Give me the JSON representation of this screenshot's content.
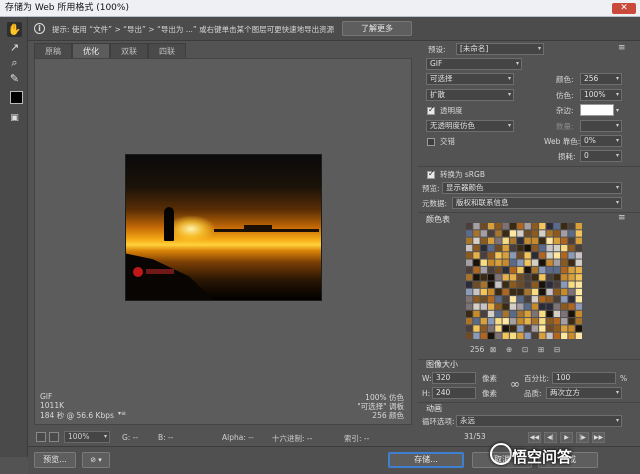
{
  "window": {
    "title": "存储为 Web 所用格式 (100%)",
    "close": "✕"
  },
  "hint": {
    "text": "提示:  使用 “文件” > “导出” > “导出为 ...” 或右键单击某个图层可更快速地导出资源",
    "learn_more": "了解更多"
  },
  "tabs": [
    "原稿",
    "优化",
    "双联",
    "四联"
  ],
  "canvas_info": {
    "format": "GIF",
    "size": "1011K",
    "time": "184 秒 @ 56.6 Kbps",
    "dither_pct": "100% 仿色",
    "palette": "\"可选择\" 调板",
    "colors": "256 颜色"
  },
  "status": {
    "zoom": "100%",
    "g": "G: --",
    "b": "B: --",
    "alpha": "Alpha: --",
    "hex": "十六进制: --",
    "index": "索引: --"
  },
  "bottom": {
    "preview": "预览...",
    "save": "存储...",
    "cancel": "取消",
    "done": "完成"
  },
  "settings": {
    "preset_label": "预设:",
    "preset_value": "[未命名]",
    "format": "GIF",
    "reduction": "可选择",
    "dither_algo": "扩散",
    "colors_label": "颜色:",
    "colors_value": "256",
    "dither_label": "仿色:",
    "dither_value": "100%",
    "transparency_label": "透明度",
    "matte_label": "杂边:",
    "amount_label": "数量:",
    "no_transparency_dither": "无透明度仿色",
    "interlaced_label": "交错",
    "web_snap_label": "Web 靠色:",
    "web_snap_value": "0%",
    "lossy_label": "损耗:",
    "lossy_value": "0",
    "srgb_label": "转换为 sRGB",
    "preview_label": "预览:",
    "preview_value": "显示器颜色",
    "metadata_label": "元数据:",
    "metadata_value": "版权和联系信息",
    "color_table_label": "颜色表",
    "palette_count": "256"
  },
  "image_size": {
    "title": "图像大小",
    "w_label": "W:",
    "w_value": "320",
    "w_unit": "像素",
    "h_label": "H:",
    "h_value": "240",
    "h_unit": "像素",
    "percent_label": "百分比:",
    "percent_value": "100",
    "percent_unit": "%",
    "quality_label": "品质:",
    "quality_value": "两次立方"
  },
  "animation": {
    "title": "动画",
    "loop_label": "循环选项:",
    "loop_value": "永远",
    "frame": "31/53"
  },
  "watermark": "悟空问答"
}
